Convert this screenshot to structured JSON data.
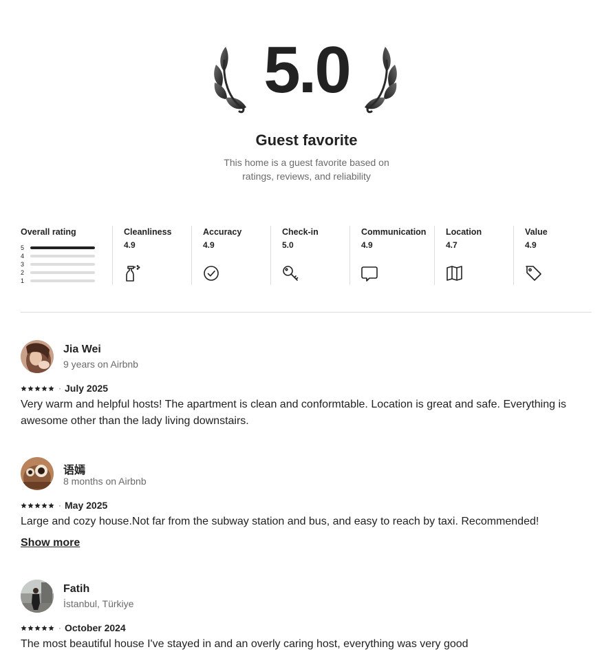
{
  "hero": {
    "rating": "5.0",
    "title": "Guest favorite",
    "subtitle_line1": "This home is a guest favorite based on",
    "subtitle_line2": "ratings, reviews, and reliability"
  },
  "overall": {
    "label": "Overall rating",
    "distribution": [
      {
        "stars": "5",
        "fraction": 1.0
      },
      {
        "stars": "4",
        "fraction": 0.0
      },
      {
        "stars": "3",
        "fraction": 0.0
      },
      {
        "stars": "2",
        "fraction": 0.0
      },
      {
        "stars": "1",
        "fraction": 0.0
      }
    ]
  },
  "categories": [
    {
      "label": "Cleanliness",
      "score": "4.9",
      "icon": "spray-bottle-icon"
    },
    {
      "label": "Accuracy",
      "score": "4.9",
      "icon": "check-circle-icon"
    },
    {
      "label": "Check-in",
      "score": "5.0",
      "icon": "key-icon"
    },
    {
      "label": "Communication",
      "score": "4.9",
      "icon": "message-icon"
    },
    {
      "label": "Location",
      "score": "4.7",
      "icon": "map-icon"
    },
    {
      "label": "Value",
      "score": "4.9",
      "icon": "tag-icon"
    }
  ],
  "reviews": [
    {
      "name": "Jia Wei",
      "meta": "9 years on Airbnb",
      "rating": 5,
      "date": "July 2025",
      "text": "Very warm and helpful hosts! The apartment is clean and conformtable. Location is great and safe. Everything is awesome other than the lady living downstairs."
    },
    {
      "name": "语嫣",
      "meta": "8 months on Airbnb",
      "rating": 5,
      "date": "May 2025",
      "text": "Large and cozy house.Not far from the subway station and bus, and easy to reach by taxi. Recommended!",
      "show_more": "Show more"
    },
    {
      "name": "Fatih",
      "meta": "İstanbul, Türkiye",
      "rating": 5,
      "date": "October 2024",
      "text": "The most beautiful house I've stayed in and an overly caring host, everything was very good"
    }
  ],
  "separator": "·",
  "colors": {
    "text": "#222222",
    "muted": "#6a6a6a",
    "border": "#dddddd"
  }
}
